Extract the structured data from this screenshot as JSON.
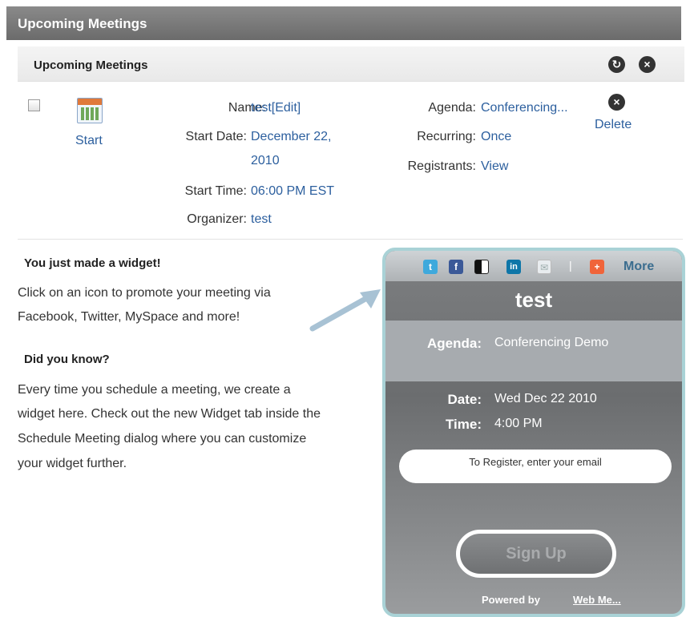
{
  "header": {
    "title": "Upcoming Meetings"
  },
  "panel": {
    "title": "Upcoming Meetings",
    "icons": {
      "refresh": "refresh-icon",
      "close": "close-icon"
    }
  },
  "meeting": {
    "start_label": "Start",
    "name_label": "Name:",
    "name_value": "test[Edit]",
    "start_date_label": "Start Date:",
    "start_date_line1": "December 22,",
    "start_date_line2": "2010",
    "start_time_label": "Start Time:",
    "start_time_value": "06:00 PM EST",
    "organizer_label": "Organizer:",
    "organizer_value": "test",
    "agenda_label": "Agenda:",
    "agenda_value": "Conferencing...",
    "recurring_label": "Recurring:",
    "recurring_value": "Once",
    "registrants_label": "Registrants:",
    "registrants_value": "View",
    "delete_label": "Delete"
  },
  "promo": {
    "heading1": "You just made a widget!",
    "text1_line1": "Click on an icon to promote your meeting via",
    "text1_line2": "Facebook, Twitter, MySpace and more!",
    "heading2": "Did you know?",
    "text2_line1": "Every time you schedule a meeting, we create a",
    "text2_line2": "widget here. Check out the new Widget tab inside the",
    "text2_line3": "Schedule Meeting dialog where you can customize",
    "text2_line4": "your widget further."
  },
  "widget": {
    "social_more": "More",
    "title": "test",
    "agenda_label": "Agenda:",
    "agenda_value": "Conferencing Demo",
    "date_label": "Date:",
    "date_value": "Wed Dec 22 2010",
    "time_label": "Time:",
    "time_value": "4:00 PM",
    "email_placeholder": "To Register, enter your email",
    "signup_label": "Sign Up",
    "powered_by": "Powered by",
    "powered_link": "Web Me...",
    "colors": {
      "border": "#a9d2d6",
      "twitter": "#3fa9dc",
      "facebook": "#3b5998",
      "linkedin": "#0e76a8",
      "addthis": "#f0643a"
    }
  }
}
